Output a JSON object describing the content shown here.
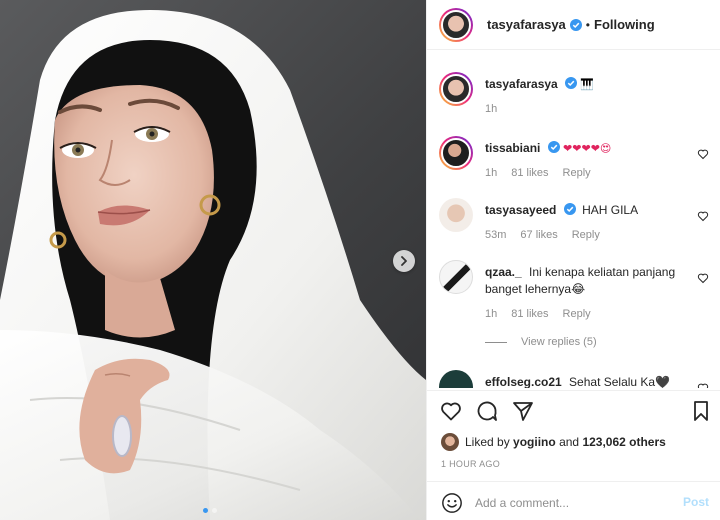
{
  "header": {
    "username": "tasyafarasya",
    "separator": "•",
    "follow_label": "Following"
  },
  "caption": {
    "username": "tasyafarasya",
    "emoji": "🎹",
    "time": "1h"
  },
  "comments": [
    {
      "username": "tissabiani",
      "text": "❤❤❤❤😍",
      "time": "1h",
      "likes": "81 likes",
      "reply": "Reply",
      "verified": true
    },
    {
      "username": "tasyasayeed",
      "text": "HAH GILA",
      "time": "53m",
      "likes": "67 likes",
      "reply": "Reply",
      "verified": true
    },
    {
      "username": "qzaa._",
      "text": "Ini kenapa keliatan panjang banget lehernya😂",
      "time": "1h",
      "likes": "81 likes",
      "reply": "Reply",
      "verified": false
    },
    {
      "username": "effolseg.co21",
      "text": "Sehat Selalu Ka🖤",
      "verified": false
    }
  ],
  "view_replies": "View replies (5)",
  "likes": {
    "prefix": "Liked by",
    "user": "yogiino",
    "middle": "and",
    "count": "123,062 others"
  },
  "timestamp": "1 HOUR AGO",
  "comment_box": {
    "placeholder": "Add a comment...",
    "post_label": "Post"
  },
  "colors": {
    "verified": "#3897f0",
    "post_disabled": "#b2dffc",
    "muted": "#8e8e8e"
  },
  "icons": [
    "heart-icon",
    "comment-icon",
    "share-icon",
    "bookmark-icon",
    "emoji-icon",
    "verified-icon",
    "chevron-right-icon"
  ]
}
